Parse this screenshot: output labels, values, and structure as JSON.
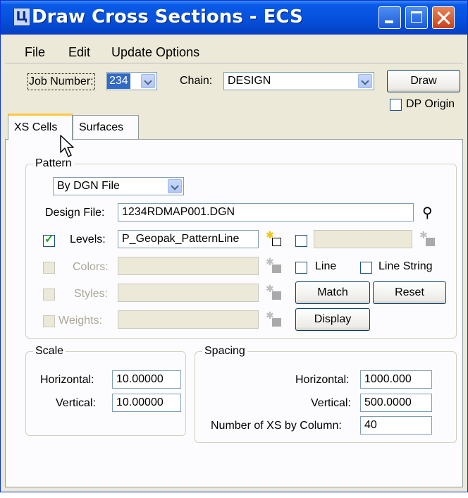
{
  "window": {
    "title": "Draw Cross Sections - ECS",
    "app_icon_glyph": "Ц"
  },
  "menu": [
    "File",
    "Edit",
    "Update Options"
  ],
  "toolbar": {
    "job_label": "Job Number:",
    "job_value": "234",
    "chain_label": "Chain:",
    "chain_value": "DESIGN",
    "draw_label": "Draw",
    "dp_origin_label": "DP Origin",
    "dp_origin_checked": false
  },
  "tabs": [
    "XS Cells",
    "Surfaces"
  ],
  "pattern": {
    "legend": "Pattern",
    "mode": "By DGN File",
    "design_file_label": "Design File:",
    "design_file_value": "1234RDMAP001.DGN",
    "levels_label": "Levels:",
    "levels_value": "P_Geopak_PatternLine",
    "levels_checked": true,
    "colors_label": "Colors:",
    "styles_label": "Styles:",
    "weights_label": "Weights:",
    "line_label": "Line",
    "line_string_label": "Line String",
    "match_label": "Match",
    "reset_label": "Reset",
    "display_label": "Display"
  },
  "scale": {
    "legend": "Scale",
    "horizontal_label": "Horizontal:",
    "horizontal_value": "10.00000",
    "vertical_label": "Vertical:",
    "vertical_value": "10.00000"
  },
  "spacing": {
    "legend": "Spacing",
    "horizontal_label": "Horizontal:",
    "horizontal_value": "1000.000",
    "vertical_label": "Vertical:",
    "vertical_value": "500.0000",
    "count_label": "Number of XS by Column:",
    "count_value": "40"
  },
  "colors": {
    "titlebar": "#0652de",
    "face": "#ece9d8",
    "tab_highlight": "#ffc83c",
    "check": "#21a121"
  }
}
